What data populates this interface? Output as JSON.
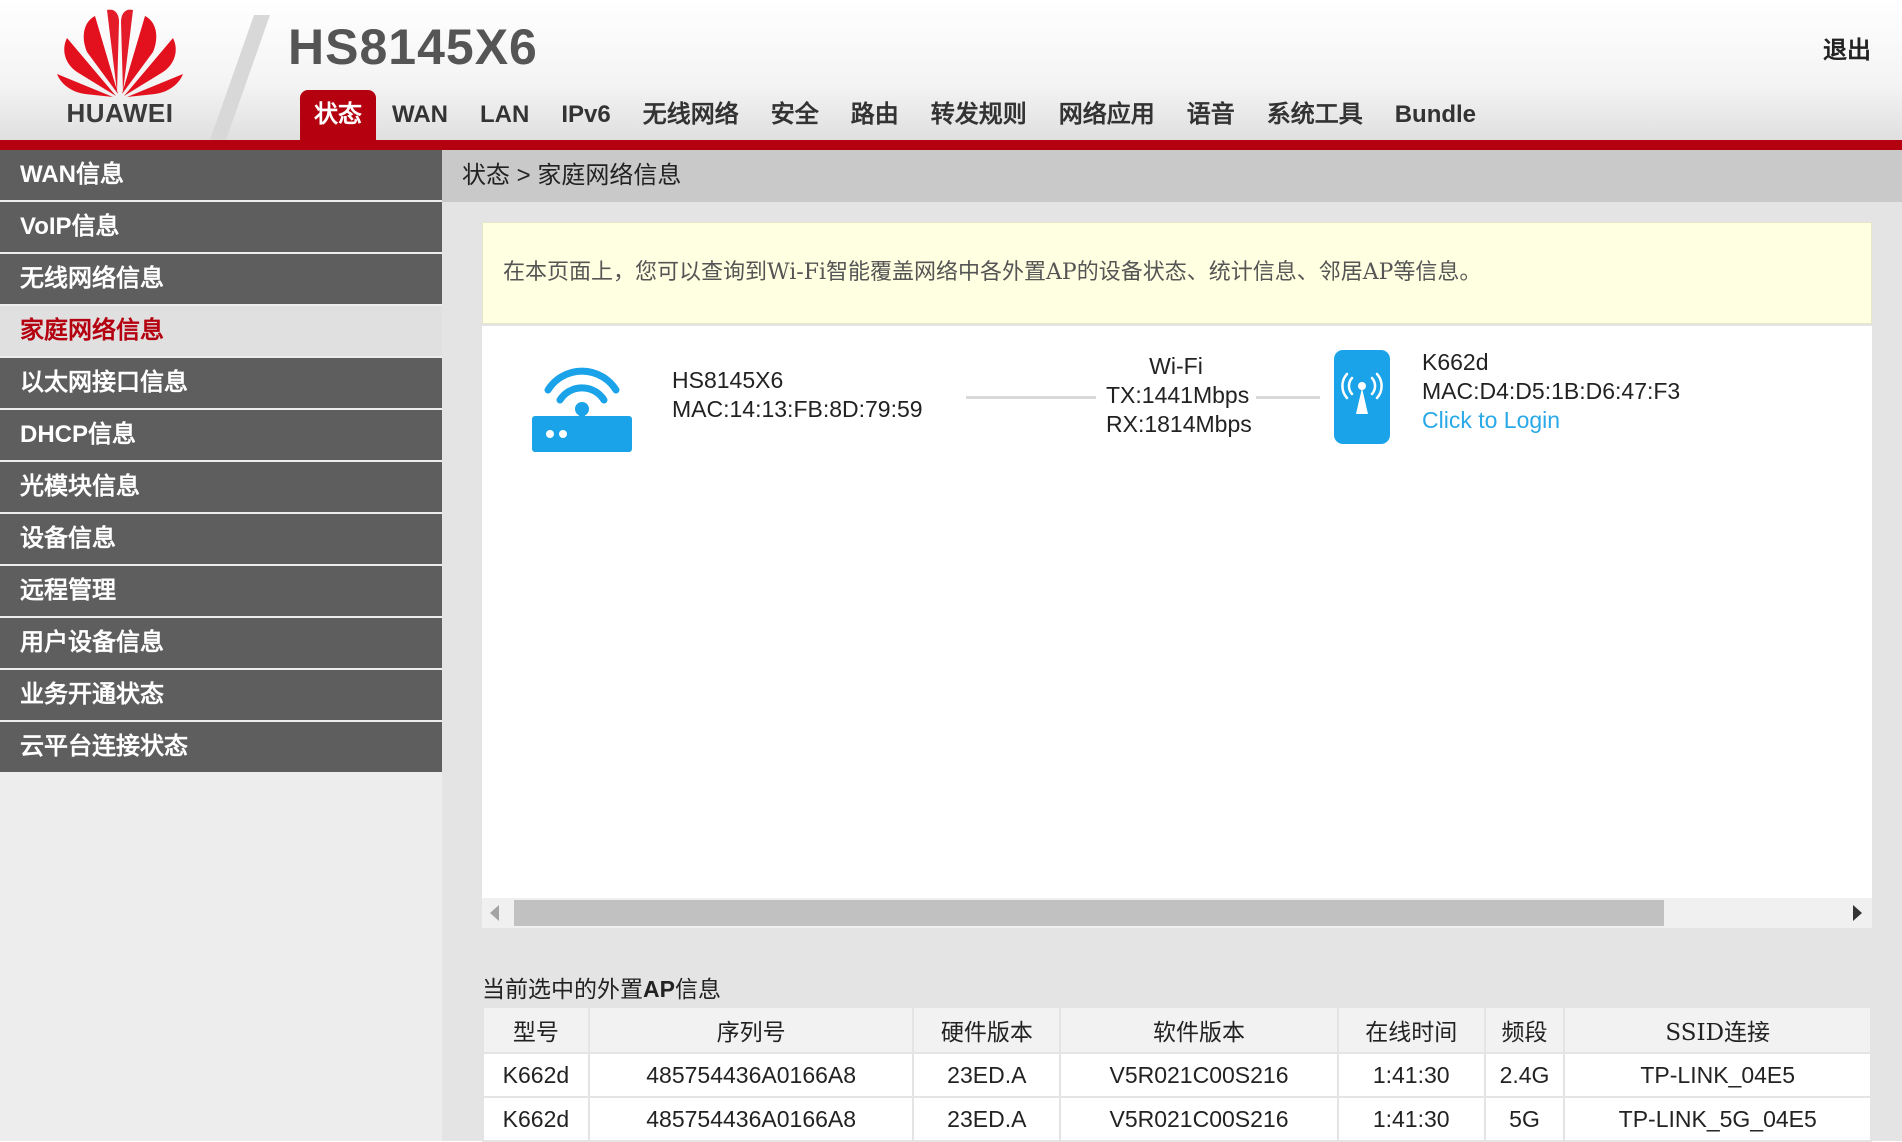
{
  "header": {
    "brand": "HUAWEI",
    "model": "HS8145X6",
    "logout": "退出",
    "brand_color": "#b5010f"
  },
  "nav": {
    "tabs": [
      "状态",
      "WAN",
      "LAN",
      "IPv6",
      "无线网络",
      "安全",
      "路由",
      "转发规则",
      "网络应用",
      "语音",
      "系统工具",
      "Bundle"
    ],
    "active": "状态"
  },
  "sidebar": {
    "items": [
      "WAN信息",
      "VoIP信息",
      "无线网络信息",
      "家庭网络信息",
      "以太网接口信息",
      "DHCP信息",
      "光模块信息",
      "设备信息",
      "远程管理",
      "用户设备信息",
      "业务开通状态",
      "云平台连接状态"
    ],
    "active": "家庭网络信息"
  },
  "breadcrumb": "状态 > 家庭网络信息",
  "notice": "在本页面上，您可以查询到Wi-Fi智能覆盖网络中各外置AP的设备状态、统计信息、邻居AP等信息。",
  "topology": {
    "gateway": {
      "name": "HS8145X6",
      "mac": "MAC:14:13:FB:8D:79:59",
      "icon": "router-icon"
    },
    "link": {
      "type": "Wi-Fi",
      "tx": "TX:1441Mbps",
      "rx": "RX:1814Mbps"
    },
    "ap": {
      "name": "K662d",
      "mac": "MAC:D4:D5:1B:D6:47:F3",
      "login": "Click to Login",
      "icon": "access-point-icon"
    }
  },
  "ap_info": {
    "title_prefix": "当前选中的外置",
    "title_bold": "AP",
    "title_suffix": "信息",
    "columns": [
      "型号",
      "序列号",
      "硬件版本",
      "软件版本",
      "在线时间",
      "频段",
      "SSID连接"
    ],
    "rows": [
      [
        "K662d",
        "485754436A0166A8",
        "23ED.A",
        "V5R021C00S216",
        "1:41:30",
        "2.4G",
        "TP-LINK_04E5"
      ],
      [
        "K662d",
        "485754436A0166A8",
        "23ED.A",
        "V5R021C00S216",
        "1:41:30",
        "5G",
        "TP-LINK_5G_04E5"
      ]
    ]
  },
  "colors": {
    "icon_blue": "#1aa3e8",
    "link_blue": "#2aa9e8"
  }
}
